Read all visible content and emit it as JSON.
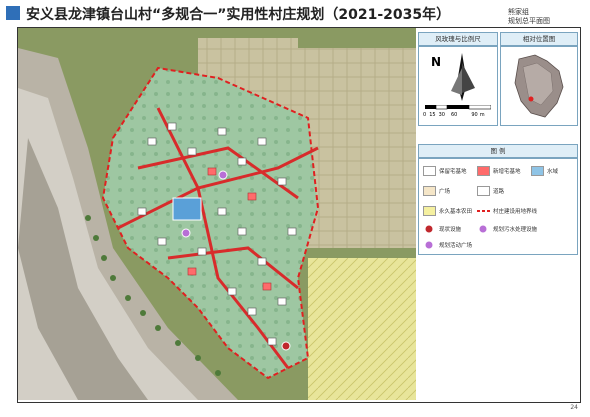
{
  "header": {
    "title": "安义县龙津镇台山村“多规合一”实用性村庄规划（2021-2035年）",
    "group_name": "熊家组",
    "plan_name": "规划总平面图"
  },
  "compass_panel": {
    "heading": "风玫瑰与比例尺",
    "north_label": "N",
    "scale_ticks": [
      "0",
      "15",
      "30",
      "60",
      "90"
    ],
    "scale_unit": "m"
  },
  "location_panel": {
    "heading": "相对位置图"
  },
  "legend": {
    "heading": "图 例",
    "items": [
      {
        "label": "保留宅基地",
        "symbol": "building-retained",
        "color": "#ffffff"
      },
      {
        "label": "新增宅基地",
        "symbol": "building-new",
        "color": "#ff6b6b"
      },
      {
        "label": "水域",
        "symbol": "water",
        "color": "#8fc4e6"
      },
      {
        "label": "广场",
        "symbol": "square",
        "color": "#f5e6c8"
      },
      {
        "label": "道路",
        "symbol": "road",
        "color": "#ffffff"
      },
      {
        "label": "永久基本农田",
        "symbol": "farmland",
        "color": "#f5f0a0"
      },
      {
        "label": "村庄建设用地界线",
        "symbol": "boundary-line",
        "color": "#e02020"
      },
      {
        "label": "现状设施",
        "symbol": "existing-facility",
        "color": "#c0282d"
      },
      {
        "label": "规划污水处理设施",
        "symbol": "sewage-facility",
        "color": "#b86fd6"
      },
      {
        "label": "规划活动广场",
        "symbol": "activity-square",
        "color": "#b86fd6"
      }
    ]
  },
  "page_number": "24"
}
